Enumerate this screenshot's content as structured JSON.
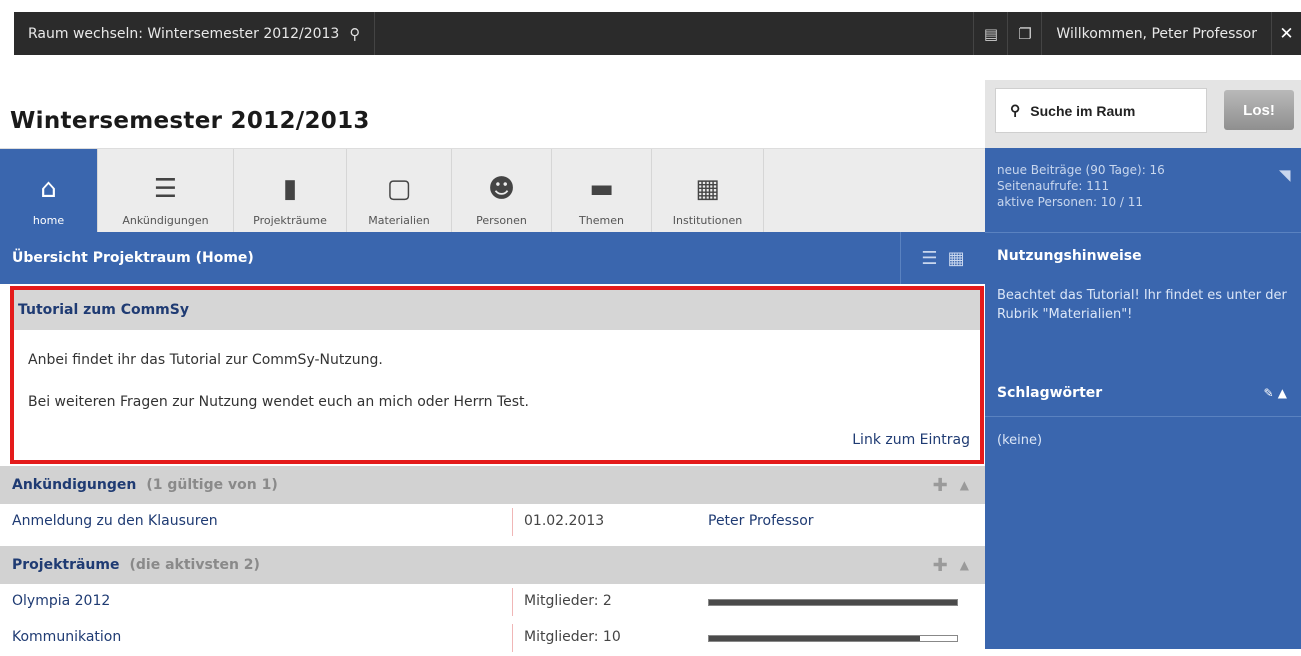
{
  "topbar": {
    "room_switch": "Raum wechseln: Wintersemester 2012/2013",
    "welcome": "Willkommen, Peter Professor",
    "close": "✕"
  },
  "page_title": "Wintersemester 2012/2013",
  "search": {
    "label": "Suche im Raum",
    "button": "Los!"
  },
  "stats": {
    "new_posts": "neue Beiträge (90 Tage): 16",
    "page_views": "Seitenaufrufe: 111",
    "active_people": "aktive Personen: 10 / 11"
  },
  "nav": {
    "tabs": [
      {
        "label": "home",
        "icon": "home-icon"
      },
      {
        "label": "Ankündigungen",
        "icon": "announcement-icon"
      },
      {
        "label": "Projekträume",
        "icon": "door-icon"
      },
      {
        "label": "Materialien",
        "icon": "document-icon"
      },
      {
        "label": "Personen",
        "icon": "people-icon"
      },
      {
        "label": "Themen",
        "icon": "folder-icon"
      },
      {
        "label": "Institutionen",
        "icon": "building-icon"
      }
    ]
  },
  "overview_title": "Übersicht Projektraum (Home)",
  "tutorial": {
    "title": "Tutorial zum CommSy",
    "line1": "Anbei findet ihr das Tutorial zur CommSy-Nutzung.",
    "line2": "Bei weiteren Fragen zur Nutzung wendet euch an mich oder Herrn Test.",
    "link": "Link zum Eintrag"
  },
  "announcements": {
    "title": "Ankündigungen",
    "sub": "(1 gültige von 1)",
    "rows": [
      {
        "title": "Anmeldung zu den Klausuren",
        "date": "01.02.2013",
        "author": "Peter Professor"
      }
    ]
  },
  "projects": {
    "title": "Projekträume",
    "sub": "(die aktivsten 2)",
    "rows": [
      {
        "title": "Olympia 2012",
        "members": "Mitglieder: 2",
        "activity": 1.0
      },
      {
        "title": "Kommunikation",
        "members": "Mitglieder: 10",
        "activity": 0.85
      }
    ]
  },
  "right": {
    "usage_title": "Nutzungshinweise",
    "usage_text": "Beachtet das Tutorial! Ihr findet es unter der Rubrik \"Materialien\"!",
    "tags_title": "Schlagwörter",
    "tags_empty": "(keine)"
  }
}
